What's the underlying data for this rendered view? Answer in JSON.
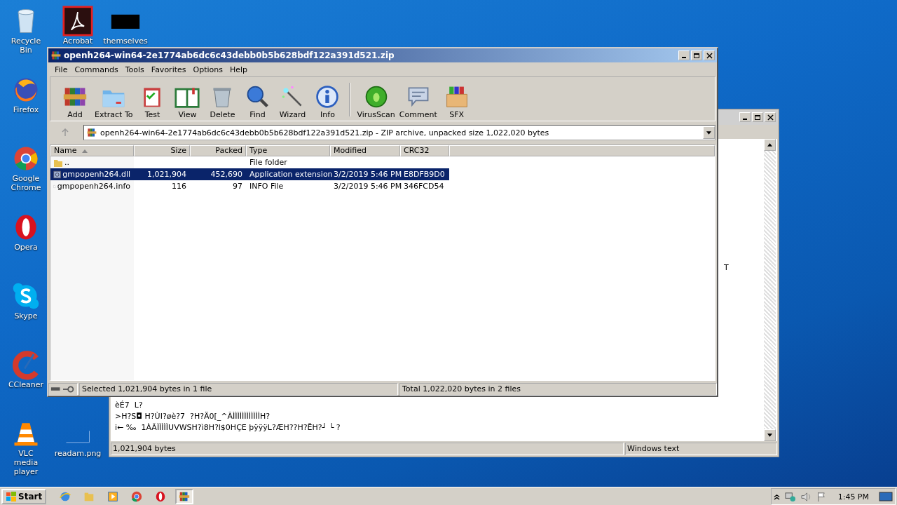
{
  "desktop_icons": [
    {
      "label": "Recycle Bin",
      "kind": "trash"
    },
    {
      "label": "Firefox",
      "kind": "firefox"
    },
    {
      "label": "Google Chrome",
      "kind": "chrome"
    },
    {
      "label": "Opera",
      "kind": "opera"
    },
    {
      "label": "Skype",
      "kind": "skype"
    },
    {
      "label": "CCleaner",
      "kind": "ccleaner"
    },
    {
      "label": "VLC media player",
      "kind": "vlc"
    },
    {
      "label": "Acrobat",
      "kind": "acrobat"
    },
    {
      "label": "themselves",
      "kind": "blank"
    },
    {
      "label": "readam.png",
      "kind": "image"
    }
  ],
  "background_window": {
    "lines": [
      "èÉ7  L?",
      ">H?S◘ H?ÙI?øè?7  ?H?Ä0[_^ÃÌÌÌÌÌÌÌÌÌÌÌÌH?",
      "i← ‰  1ÀÃÌÌÌÌÌUVWSH?ì8H?l$0HÇE þÿÿÿL?ÆH??H?ËH?┘ └ ?"
    ],
    "side_text": "T",
    "status_left": "1,021,904 bytes",
    "status_right": "Windows text"
  },
  "winrar": {
    "title": "openh264-win64-2e1774ab6dc6c43debb0b5b628bdf122a391d521.zip",
    "menu": [
      "File",
      "Commands",
      "Tools",
      "Favorites",
      "Options",
      "Help"
    ],
    "toolbar": [
      {
        "label": "Add",
        "kind": "add"
      },
      {
        "label": "Extract To",
        "kind": "extract"
      },
      {
        "label": "Test",
        "kind": "test"
      },
      {
        "label": "View",
        "kind": "view"
      },
      {
        "label": "Delete",
        "kind": "delete"
      },
      {
        "label": "Find",
        "kind": "find"
      },
      {
        "label": "Wizard",
        "kind": "wizard"
      },
      {
        "label": "Info",
        "kind": "info"
      },
      {
        "label": "VirusScan",
        "kind": "virus"
      },
      {
        "label": "Comment",
        "kind": "comment"
      },
      {
        "label": "SFX",
        "kind": "sfx"
      }
    ],
    "address": "openh264-win64-2e1774ab6dc6c43debb0b5b628bdf122a391d521.zip - ZIP archive, unpacked size 1,022,020 bytes",
    "columns": [
      {
        "label": "Name",
        "sorted": true
      },
      {
        "label": "Size",
        "sorted": false
      },
      {
        "label": "Packed",
        "sorted": false
      },
      {
        "label": "Type",
        "sorted": false
      },
      {
        "label": "Modified",
        "sorted": false
      },
      {
        "label": "CRC32",
        "sorted": false
      }
    ],
    "rows": [
      {
        "kind": "folder",
        "name": "..",
        "size": "",
        "packed": "",
        "type": "File folder",
        "modified": "",
        "crc": "",
        "selected": false
      },
      {
        "kind": "dll",
        "name": "gmpopenh264.dll",
        "size": "1,021,904",
        "packed": "452,690",
        "type": "Application extension",
        "modified": "3/2/2019 5:46 PM",
        "crc": "E8DFB9D0",
        "selected": true
      },
      {
        "kind": "file",
        "name": "gmpopenh264.info",
        "size": "116",
        "packed": "97",
        "type": "INFO File",
        "modified": "3/2/2019 5:46 PM",
        "crc": "346FCD54",
        "selected": false
      }
    ],
    "status_left": "Selected 1,021,904 bytes in 1 file",
    "status_right": "Total 1,022,020 bytes in 2 files"
  },
  "taskbar": {
    "start": "Start",
    "apps": [
      {
        "kind": "ie",
        "active": false
      },
      {
        "kind": "explorer",
        "active": false
      },
      {
        "kind": "media",
        "active": false
      },
      {
        "kind": "chrome",
        "active": false
      },
      {
        "kind": "opera",
        "active": false
      },
      {
        "kind": "winrar",
        "active": true
      }
    ],
    "clock": "1:45 PM"
  }
}
